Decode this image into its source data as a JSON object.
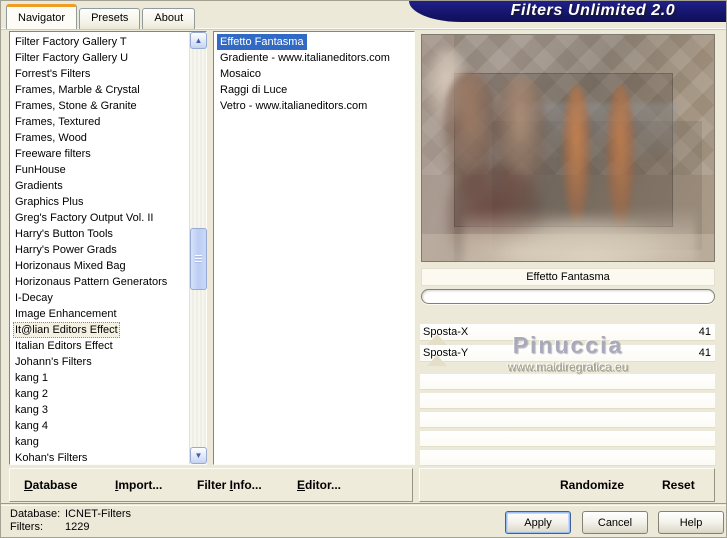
{
  "window": {
    "title": "Filters Unlimited 2.0"
  },
  "tabs": [
    {
      "label": "Navigator",
      "active": true
    },
    {
      "label": "Presets",
      "active": false
    },
    {
      "label": "About",
      "active": false
    }
  ],
  "category_list": {
    "selected_index": 18,
    "items": [
      "Filter Factory Gallery T",
      "Filter Factory Gallery U",
      "Forrest's Filters",
      "Frames, Marble & Crystal",
      "Frames, Stone & Granite",
      "Frames, Textured",
      "Frames, Wood",
      "Freeware filters",
      "FunHouse",
      "Gradients",
      "Graphics Plus",
      "Greg's Factory Output Vol. II",
      "Harry's Button Tools",
      "Harry's Power Grads",
      "Horizonaus Mixed Bag",
      "Horizonaus Pattern Generators",
      "I-Decay",
      "Image Enhancement",
      "It@lian Editors Effect",
      "Italian Editors Effect",
      "Johann's Filters",
      "kang 1",
      "kang 2",
      "kang 3",
      "kang 4",
      "kang",
      "Kohan's Filters"
    ]
  },
  "filter_list": {
    "selected_index": 0,
    "items": [
      "Effetto Fantasma",
      "Gradiente - www.italianeditors.com",
      "Mosaico",
      "Raggi di Luce",
      "Vetro - www.italianeditors.com"
    ]
  },
  "preview": {
    "caption": "Effetto Fantasma"
  },
  "watermark": {
    "title": "Pinuccia",
    "url": "www.maidiregrafica.eu"
  },
  "sliders": {
    "rows": [
      {
        "label": "Sposta-X",
        "value": "41"
      },
      {
        "label": "Sposta-Y",
        "value": "41"
      }
    ],
    "empty_slots": 5
  },
  "toolbar_left": [
    {
      "label": "Database",
      "underline_index": 0
    },
    {
      "label": "Import...",
      "underline_index": 0
    },
    {
      "label": "Filter Info...",
      "underline_index": 7
    },
    {
      "label": "Editor...",
      "underline_index": 0
    }
  ],
  "toolbar_right": [
    {
      "label": "Randomize"
    },
    {
      "label": "Reset"
    }
  ],
  "status": {
    "database_label": "Database:",
    "database_value": "ICNET-Filters",
    "filters_label": "Filters:",
    "filters_value": "1229"
  },
  "action_buttons": [
    {
      "label": "Apply",
      "default": true
    },
    {
      "label": "Cancel",
      "default": false
    },
    {
      "label": "Help",
      "default": false
    }
  ],
  "scrollbar": {
    "up_icon": "▲",
    "down_icon": "▼"
  },
  "colors": {
    "dialog_bg": "#ECE9D8",
    "banner": "#14146A",
    "selection": "#316AC5",
    "tab_accent": "#EF9C25"
  }
}
